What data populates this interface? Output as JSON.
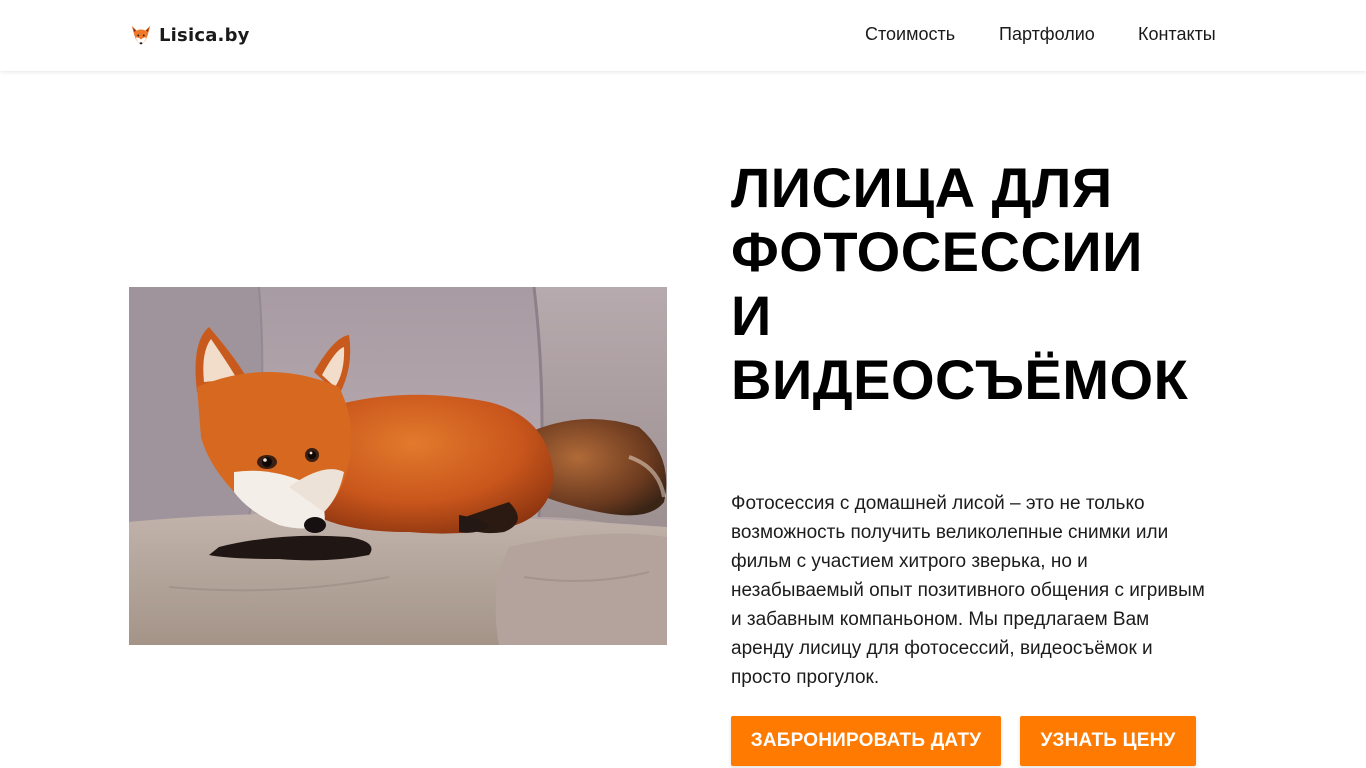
{
  "header": {
    "logo_text": "Lisica.by",
    "nav": [
      {
        "label": "Стоимость"
      },
      {
        "label": "Партфолио"
      },
      {
        "label": "Контакты"
      }
    ]
  },
  "hero": {
    "title_lines": [
      "ЛИСИЦА ДЛЯ",
      "ФОТОСЕССИИ",
      "И",
      "ВИДЕОСЪЁМОК"
    ],
    "description": "Фотосессия с домашней лисой – это не только возможность получить великолепные снимки или фильм с участием хитрого зверька, но и незабываемый опыт позитивного общения с игривым и забавным компаньоном. Мы предлагаем Вам аренду лисицу для фотосессий, видеосъёмок и просто прогулок.",
    "buttons": {
      "book_date": "ЗАБРОНИРОВАТЬ ДАТУ",
      "get_price": "УЗНАТЬ ЦЕНУ"
    },
    "image_icon": "fox-on-sofa-photo"
  },
  "colors": {
    "accent": "#ff7a00",
    "text": "#111111",
    "background": "#ffffff"
  }
}
